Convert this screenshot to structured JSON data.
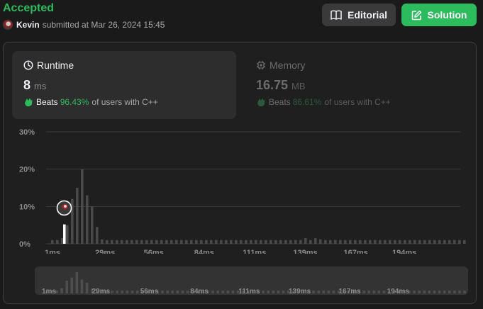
{
  "header": {
    "status": "Accepted",
    "user": "Kevin",
    "submitted_text": "submitted at Mar 26, 2024 15:45",
    "editorial_label": "Editorial",
    "solution_label": "Solution"
  },
  "runtime": {
    "title": "Runtime",
    "value": "8",
    "unit": "ms",
    "beats_label": "Beats",
    "beats_pct": "96.43%",
    "beats_suffix": "of users with C++"
  },
  "memory": {
    "title": "Memory",
    "value": "16.75",
    "unit": "MB",
    "beats_label": "Beats",
    "beats_pct": "86.61%",
    "beats_suffix": "of users with C++"
  },
  "colors": {
    "accent": "#2cbb5d",
    "bar": "#4a4a4a",
    "bar_selected": "#ffffff",
    "grid": "#3e3e3e"
  },
  "chart_data": {
    "type": "bar",
    "ylabel": "",
    "xlabel": "",
    "ylim": [
      0,
      30
    ],
    "yticks": [
      "0%",
      "10%",
      "20%",
      "30%"
    ],
    "ytick_values": [
      0,
      10,
      20,
      30
    ],
    "xticks": [
      "1ms",
      "29ms",
      "56ms",
      "84ms",
      "111ms",
      "139ms",
      "167ms",
      "194ms"
    ],
    "xlim": [
      1,
      231
    ],
    "bin_width_ms": 3.9,
    "selected_value_ms": 8,
    "values": [
      1.0,
      1.0,
      1.5,
      5.0,
      12.0,
      15.0,
      20.0,
      13.0,
      10.0,
      4.5,
      1.2,
      1.0,
      1.0,
      1.0,
      1.0,
      1.0,
      1.0,
      1.0,
      1.0,
      1.0,
      1.0,
      1.0,
      1.0,
      1.0,
      1.0,
      1.0,
      1.0,
      1.0,
      1.0,
      1.0,
      1.0,
      1.0,
      1.0,
      1.0,
      1.0,
      1.0,
      1.0,
      1.0,
      1.0,
      1.0,
      1.0,
      1.0,
      1.0,
      1.0,
      1.0,
      1.0,
      1.0,
      1.0,
      1.0,
      1.0,
      1.0,
      1.5,
      1.0,
      1.5,
      1.2,
      1.0,
      1.0,
      1.0,
      1.0,
      1.0,
      1.0,
      1.0,
      1.0,
      1.0,
      1.0,
      1.0,
      1.0,
      1.0,
      1.0,
      1.0,
      1.0,
      1.0,
      1.0,
      1.0,
      1.0,
      1.0,
      1.0,
      1.0,
      1.0,
      1.0,
      1.0,
      1.0,
      1.0,
      1.0
    ],
    "selected_index": 2
  },
  "mini_chart": {
    "xticks": [
      "1ms",
      "29ms",
      "56ms",
      "84ms",
      "111ms",
      "139ms",
      "167ms",
      "194ms"
    ]
  }
}
